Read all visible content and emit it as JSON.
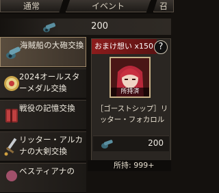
{
  "tabs": [
    "通常",
    "イベント",
    "召"
  ],
  "currency": {
    "icon": "cannon-icon",
    "amount": "200"
  },
  "list_items": [
    {
      "label": "海賊船の大砲交換",
      "icon": "cannon-icon",
      "selected": true
    },
    {
      "label": "2024オールスターメダル交換",
      "icon": "medal-icon",
      "selected": false
    },
    {
      "label": "戦役の記憶交換",
      "icon": "book-icon",
      "selected": false
    },
    {
      "label": "リッター・アルカナの大剣交換",
      "icon": "sword-icon",
      "selected": false
    },
    {
      "label": "ベスティアナの",
      "icon": "misc-icon",
      "selected": false
    }
  ],
  "detail": {
    "title": "おまけ想い x150",
    "help": "?",
    "owned_badge": "所持済",
    "item_name": "［ゴーストシップ］リッター・フォカロル",
    "price_icon": "cannon-icon",
    "price": "200",
    "owned_count": "所持: 999+"
  },
  "colors": {
    "accent": "#8c1c1c",
    "frame": "#c9b389"
  }
}
